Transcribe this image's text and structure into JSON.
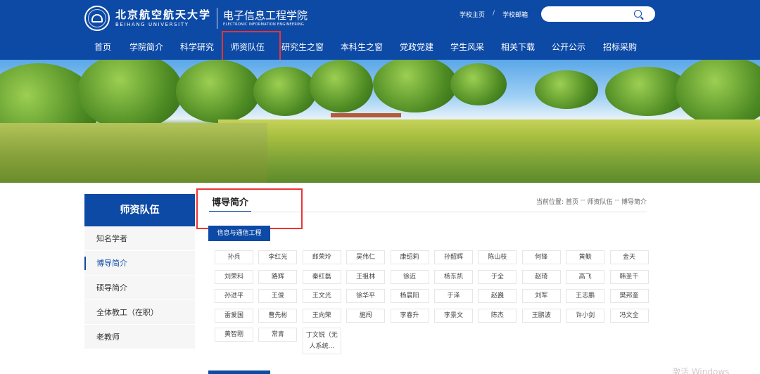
{
  "header": {
    "university_cn": "北京航空航天大学",
    "university_en": "BEIHANG UNIVERSITY",
    "school_cn": "电子信息工程学院",
    "school_en": "ELECTRONIC INFORMATION ENGINEERING",
    "links": [
      "学校主页",
      "学校邮箱"
    ],
    "link_separator": "/",
    "search_placeholder": ""
  },
  "nav": {
    "items": [
      "首页",
      "学院简介",
      "科学研究",
      "师资队伍",
      "研究生之窗",
      "本科生之窗",
      "党政党建",
      "学生风采",
      "相关下载",
      "公开公示",
      "招标采购"
    ],
    "active_index": 3
  },
  "sidebar": {
    "title": "师资队伍",
    "items": [
      "知名学者",
      "博导简介",
      "硕导简介",
      "全体教工（在职）",
      "老教师"
    ],
    "active_index": 1
  },
  "main": {
    "title": "博导简介",
    "breadcrumb": [
      "当前位置:",
      "首页",
      "--",
      "师资队伍",
      "--",
      "博导简介"
    ],
    "category": "信息与通信工程",
    "people": [
      "孙兵",
      "李红光",
      "郎荣玲",
      "吴伟仁",
      "康绍莉",
      "孙韶辉",
      "陈山枝",
      "何锋",
      "黄勤",
      "金天",
      "刘荣科",
      "路辉",
      "秦红磊",
      "王祖林",
      "徐迈",
      "杨东凯",
      "于全",
      "赵琦",
      "高飞",
      "韩圣千",
      "孙进平",
      "王俊",
      "王文光",
      "徐华平",
      "杨晨阳",
      "于泽",
      "赵巍",
      "刘军",
      "王志鹏",
      "樊邦奎",
      "雷爱国",
      "曹先彬",
      "王向荣",
      "施闯",
      "李春升",
      "李景文",
      "陈杰",
      "王鹏波",
      "许小剑",
      "冯文全",
      "黄智刚",
      "常青",
      "丁文锐（无人系统..."
    ]
  },
  "colors": {
    "brand_blue": "#0d4aa6",
    "highlight_red": "#e33333"
  },
  "watermark": "激活 Windows"
}
